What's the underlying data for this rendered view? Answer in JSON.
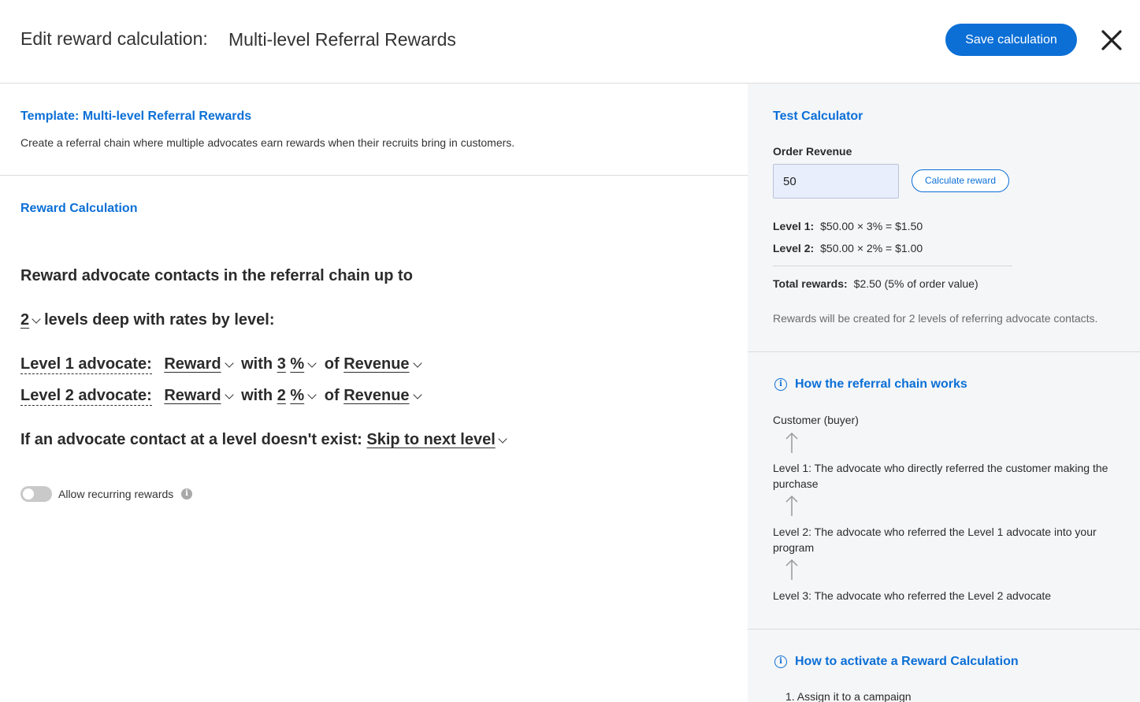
{
  "header": {
    "title_prefix": "Edit reward calculation:",
    "title_name": "Multi-level Referral Rewards",
    "save_label": "Save calculation",
    "accent": "#0b6fd6"
  },
  "template": {
    "title": "Template: Multi-level Referral Rewards",
    "description": "Create a referral chain where multiple advocates earn rewards when their recruits bring in customers."
  },
  "reward_calc": {
    "section_title": "Reward Calculation",
    "line1": "Reward advocate contacts in the referral chain up to",
    "levels_value": "2",
    "line2_suffix": "levels deep with rates by level:",
    "levels": [
      {
        "label": "Level 1 advocate:",
        "reward": "Reward",
        "with": "with",
        "rate": "3",
        "unit": "%",
        "of": "of",
        "basis": "Revenue"
      },
      {
        "label": "Level 2 advocate:",
        "reward": "Reward",
        "with": "with",
        "rate": "2",
        "unit": "%",
        "of": "of",
        "basis": "Revenue"
      }
    ],
    "missing_label": "If an advocate contact at a level doesn't exist:",
    "missing_value": "Skip to next level",
    "recurring_label": "Allow recurring rewards",
    "recurring_enabled": false
  },
  "test_calculator": {
    "title": "Test Calculator",
    "revenue_label": "Order Revenue",
    "revenue_value": "50",
    "calc_button": "Calculate reward",
    "results": [
      {
        "label": "Level 1:",
        "value": "$50.00 × 3% = $1.50"
      },
      {
        "label": "Level 2:",
        "value": "$50.00 × 2% = $1.00"
      }
    ],
    "total_label": "Total rewards:",
    "total_value": "$2.50 (5% of order value)",
    "note": "Rewards will be created for 2 levels of referring advocate contacts."
  },
  "chain_info": {
    "title": "How the referral chain works",
    "items": [
      "Customer (buyer)",
      "Level 1: The advocate who directly referred the customer making the purchase",
      "Level 2: The advocate who referred the Level 1 advocate into your program",
      "Level 3: The advocate who referred the Level 2 advocate"
    ]
  },
  "activate_info": {
    "title": "How to activate a Reward Calculation",
    "steps": [
      "1. Assign it to a campaign"
    ]
  }
}
